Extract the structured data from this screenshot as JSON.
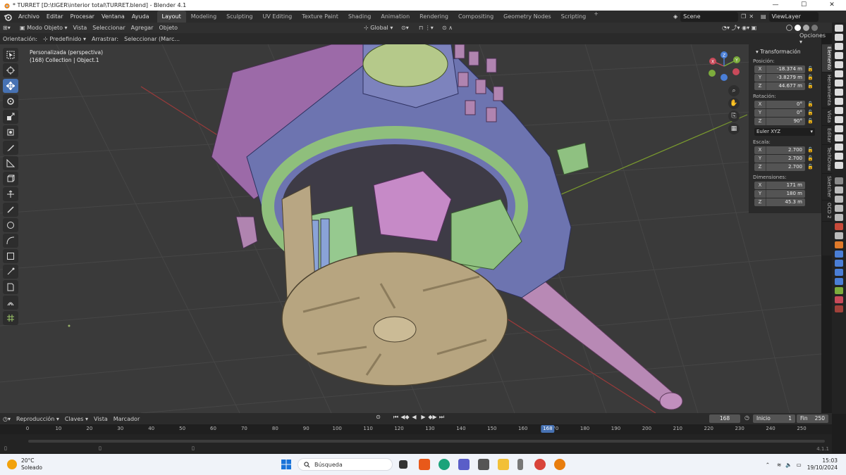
{
  "window": {
    "title": "* TURRET [D:\\tIGER\\interior total\\TURRET.blend] - Blender 4.1",
    "controls": [
      "—",
      "☐",
      "✕"
    ]
  },
  "menu": [
    "Archivo",
    "Editar",
    "Procesar",
    "Ventana",
    "Ayuda"
  ],
  "workspaces": {
    "tabs": [
      "Layout",
      "Modeling",
      "Sculpting",
      "UV Editing",
      "Texture Paint",
      "Shading",
      "Animation",
      "Rendering",
      "Compositing",
      "Geometry Nodes",
      "Scripting"
    ],
    "active": "Layout",
    "plus": "+"
  },
  "scene": {
    "name": "Scene",
    "view_layer": "ViewLayer"
  },
  "header": {
    "mode": "Modo Objeto",
    "items": [
      "Vista",
      "Seleccionar",
      "Agregar",
      "Objeto"
    ],
    "transform_orientation": "Global",
    "options": "Opciones"
  },
  "subheader": {
    "orientation_label": "Orientación:",
    "orientation_value": "Predefinido",
    "drag_label": "Arrastrar:",
    "drag_value": "Seleccionar (Marc..."
  },
  "viewport": {
    "view_name": "Personalizada (perspectiva)",
    "collection_info": "(168) Collection | Object.1"
  },
  "gizmo": {
    "x": "X",
    "y": "Y",
    "z": "Z"
  },
  "npanel": {
    "section": "Transformación",
    "position_label": "Posición:",
    "position": [
      {
        "axis": "X",
        "value": "-18.374 m"
      },
      {
        "axis": "Y",
        "value": "-3.8279 m"
      },
      {
        "axis": "Z",
        "value": "44.677 m"
      }
    ],
    "rotation_label": "Rotación:",
    "rotation": [
      {
        "axis": "X",
        "value": "0°"
      },
      {
        "axis": "Y",
        "value": "0°"
      },
      {
        "axis": "Z",
        "value": "90°"
      }
    ],
    "rotation_mode": "Euler XYZ",
    "scale_label": "Escala:",
    "scale": [
      {
        "axis": "X",
        "value": "2.700"
      },
      {
        "axis": "Y",
        "value": "2.700"
      },
      {
        "axis": "Z",
        "value": "2.700"
      }
    ],
    "dimensions_label": "Dimensiones:",
    "dimensions": [
      {
        "axis": "X",
        "value": "171 m"
      },
      {
        "axis": "Y",
        "value": "180 m"
      },
      {
        "axis": "Z",
        "value": "45.3 m"
      }
    ]
  },
  "vtabs": [
    "Elemento",
    "Herramienta",
    "Vista",
    "Editar",
    "TechDraw",
    "Sketcher",
    "OCD 2"
  ],
  "timeline": {
    "menu": [
      "Reproducción",
      "Claves",
      "Vista",
      "Marcador"
    ],
    "current_frame": "168",
    "start_label": "Inicio",
    "start": "1",
    "end_label": "Fin",
    "end": "250",
    "ticks": [
      "0",
      "10",
      "20",
      "30",
      "40",
      "50",
      "60",
      "70",
      "80",
      "90",
      "100",
      "110",
      "120",
      "130",
      "140",
      "150",
      "160",
      "170",
      "180",
      "190",
      "200",
      "210",
      "220",
      "230",
      "240",
      "250"
    ],
    "version": "4.1.1"
  },
  "taskbar": {
    "temperature": "20°C",
    "weather": "Soleado",
    "search_placeholder": "Búsqueda",
    "time": "15:03",
    "date": "19/10/2024"
  }
}
